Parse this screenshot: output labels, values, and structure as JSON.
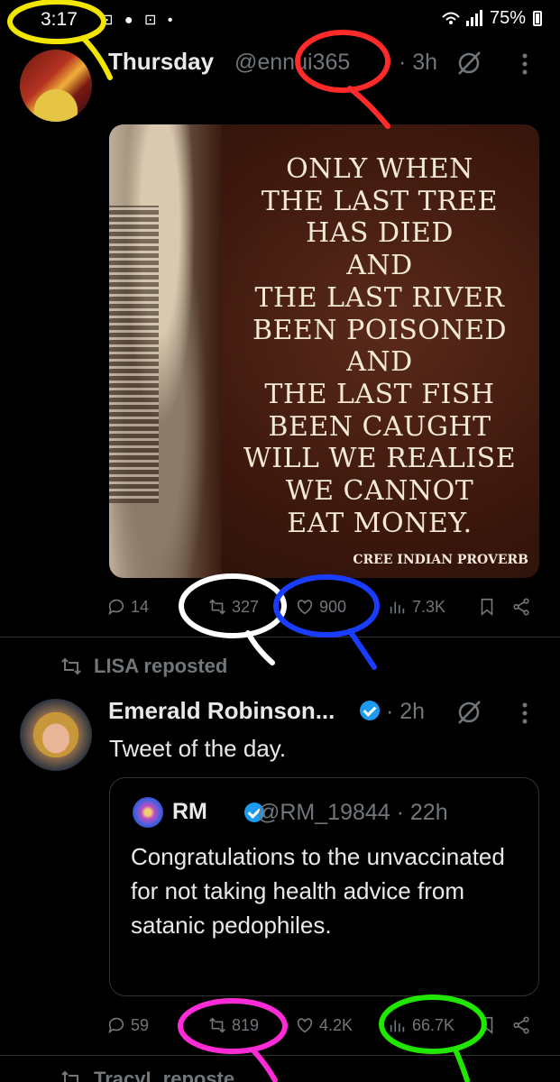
{
  "status_bar": {
    "time": "3:17",
    "left_icons": "⊡ ● ⊡ •",
    "battery": "75%"
  },
  "tweet1": {
    "name": "Thursday",
    "handle": "@ennui365",
    "time": "· 3h",
    "image": {
      "quote_lines": [
        "ONLY WHEN",
        "THE LAST TREE",
        "HAS DIED",
        "AND",
        "THE LAST RIVER",
        "BEEN POISONED",
        "AND",
        "THE LAST FISH",
        "BEEN CAUGHT",
        "WILL WE REALISE",
        "WE CANNOT",
        "EAT MONEY."
      ],
      "attribution": "CREE INDIAN PROVERB"
    },
    "actions": {
      "replies": "14",
      "reposts": "327",
      "likes": "900",
      "views": "7.3K"
    }
  },
  "repost_label": "LISA reposted",
  "tweet2": {
    "name": "Emerald Robinson...",
    "time": "· 2h",
    "text": "Tweet of the day.",
    "quoted": {
      "name": "RM",
      "handle": "@RM_19844 · 22h",
      "text": "Congratulations to the unvaccinated for not taking health advice from satanic pedophiles."
    },
    "actions": {
      "replies": "59",
      "reposts": "819",
      "likes": "4.2K",
      "views": "66.7K"
    }
  },
  "next_repost_label": "TracyL reposte",
  "annotation_colors": {
    "yellow": "#f2e600",
    "red": "#ff2a2a",
    "white": "#ffffff",
    "blue": "#1a3cff",
    "magenta": "#ff2bd6",
    "green": "#21e600"
  }
}
